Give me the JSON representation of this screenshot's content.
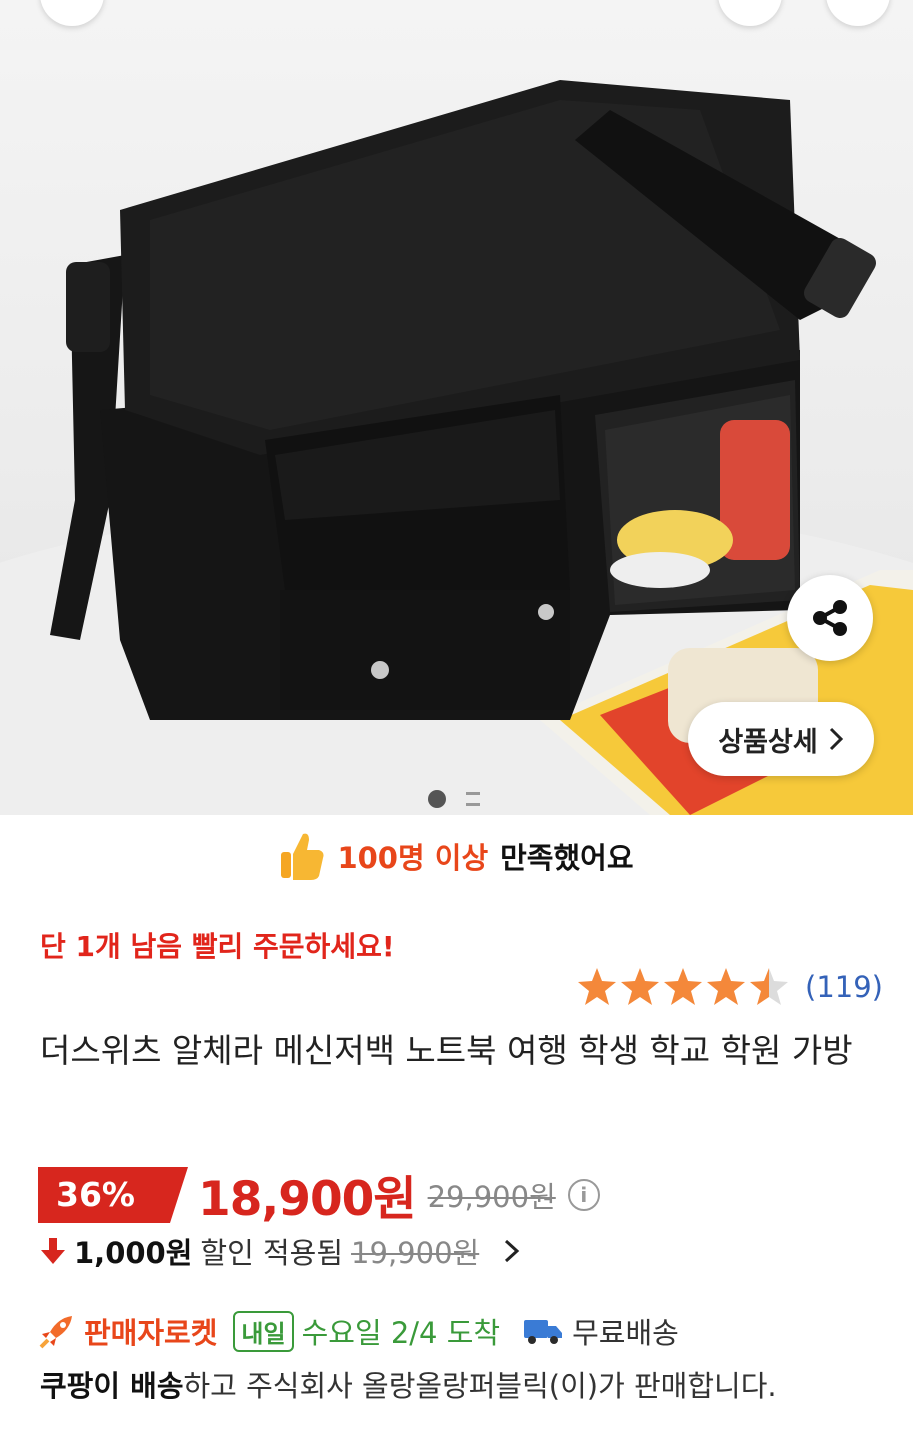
{
  "hero": {
    "detail_button_label": "상품상세",
    "image_count": 2,
    "current_image": 1
  },
  "satisfaction": {
    "highlight": "100명 이상",
    "text": "만족했어요"
  },
  "stock_warning": "단 1개 남음 빨리 주문하세요!",
  "rating": {
    "stars": 4.5,
    "count": "(119)"
  },
  "product_title": "더스위츠 알체라 메신저백 노트북 여행 학생 학교 학원 가방",
  "price": {
    "discount_badge": "36%",
    "sale_price": "18,900원",
    "original_price": "29,900원"
  },
  "coupon": {
    "amount": "1,000원",
    "label": "할인 적용됨",
    "final_price": "19,900원"
  },
  "delivery": {
    "rocket_label": "판매자로켓",
    "tomorrow_badge": "내일",
    "arrival": "수요일 2/4 도착",
    "free_shipping": "무료배송"
  },
  "seller": {
    "bold": "쿠팡이 배송",
    "text": "하고 주식회사 올랑올랑퍼블릭(이)가 판매합니다."
  },
  "colors": {
    "accent_red": "#d7261e",
    "orange": "#e8461a",
    "green": "#3a9a3a",
    "link_blue": "#3462b8",
    "star": "#f4883a"
  }
}
